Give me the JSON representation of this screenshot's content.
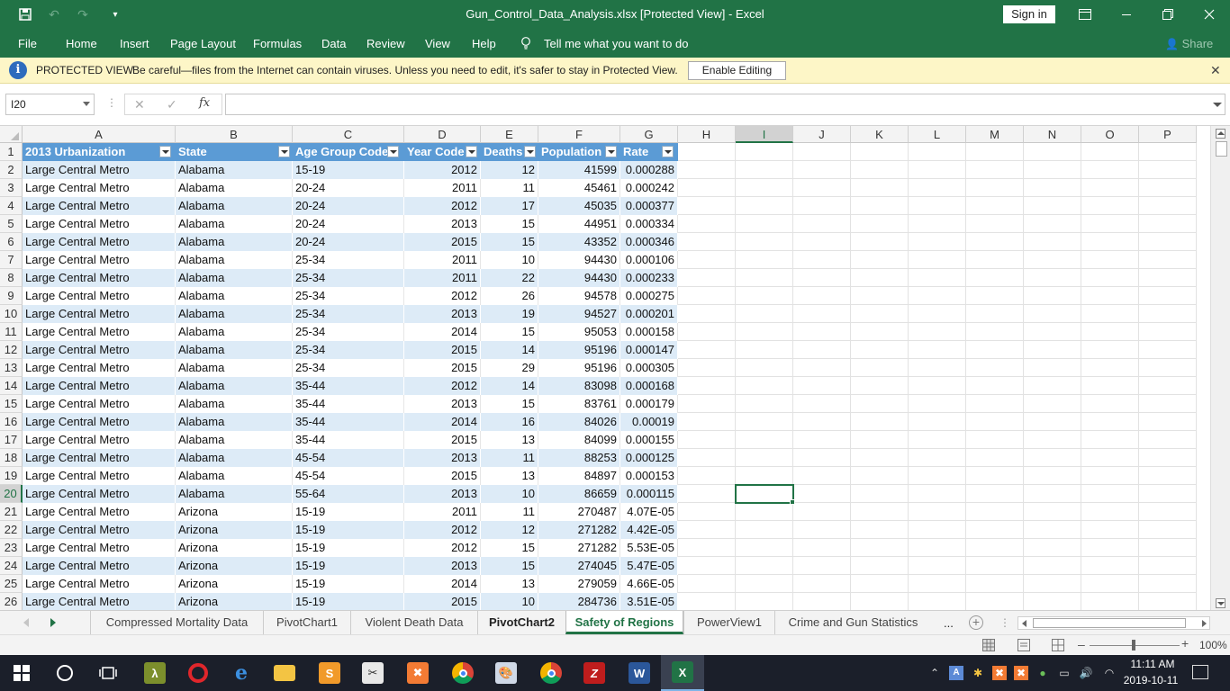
{
  "titlebar": {
    "title": "Gun_Control_Data_Analysis.xlsx  [Protected View]  -  Excel",
    "sign_in": "Sign in"
  },
  "ribbon": {
    "tabs": [
      "File",
      "Home",
      "Insert",
      "Page Layout",
      "Formulas",
      "Data",
      "Review",
      "View",
      "Help"
    ],
    "tell_me": "Tell me what you want to do",
    "share": "Share"
  },
  "protected_view": {
    "title": "PROTECTED VIEW",
    "message": "Be careful—files from the Internet can contain viruses. Unless you need to edit, it's safer to stay in Protected View.",
    "enable_button": "Enable Editing"
  },
  "formula_bar": {
    "name_box": "I20",
    "fx": "fx",
    "formula": ""
  },
  "sheet": {
    "column_letters": [
      "A",
      "B",
      "C",
      "D",
      "E",
      "F",
      "G",
      "H",
      "I",
      "J",
      "K",
      "L",
      "M",
      "N",
      "O",
      "P"
    ],
    "row_numbers": [
      "1",
      "2",
      "3",
      "4",
      "5",
      "6",
      "7",
      "8",
      "9",
      "10",
      "11",
      "12",
      "13",
      "14",
      "15",
      "16",
      "17",
      "18",
      "19",
      "20",
      "21",
      "22",
      "23",
      "24",
      "25",
      "26"
    ],
    "selected_column": "I",
    "selected_row": "20",
    "headers": [
      "2013 Urbanization",
      "State",
      "Age Group Code",
      "Year Code",
      "Deaths",
      "Population",
      "Rate"
    ],
    "rows": [
      [
        "Large Central Metro",
        "Alabama",
        "15-19",
        "2012",
        "12",
        "41599",
        "0.000288"
      ],
      [
        "Large Central Metro",
        "Alabama",
        "20-24",
        "2011",
        "11",
        "45461",
        "0.000242"
      ],
      [
        "Large Central Metro",
        "Alabama",
        "20-24",
        "2012",
        "17",
        "45035",
        "0.000377"
      ],
      [
        "Large Central Metro",
        "Alabama",
        "20-24",
        "2013",
        "15",
        "44951",
        "0.000334"
      ],
      [
        "Large Central Metro",
        "Alabama",
        "20-24",
        "2015",
        "15",
        "43352",
        "0.000346"
      ],
      [
        "Large Central Metro",
        "Alabama",
        "25-34",
        "2011",
        "10",
        "94430",
        "0.000106"
      ],
      [
        "Large Central Metro",
        "Alabama",
        "25-34",
        "2011",
        "22",
        "94430",
        "0.000233"
      ],
      [
        "Large Central Metro",
        "Alabama",
        "25-34",
        "2012",
        "26",
        "94578",
        "0.000275"
      ],
      [
        "Large Central Metro",
        "Alabama",
        "25-34",
        "2013",
        "19",
        "94527",
        "0.000201"
      ],
      [
        "Large Central Metro",
        "Alabama",
        "25-34",
        "2014",
        "15",
        "95053",
        "0.000158"
      ],
      [
        "Large Central Metro",
        "Alabama",
        "25-34",
        "2015",
        "14",
        "95196",
        "0.000147"
      ],
      [
        "Large Central Metro",
        "Alabama",
        "25-34",
        "2015",
        "29",
        "95196",
        "0.000305"
      ],
      [
        "Large Central Metro",
        "Alabama",
        "35-44",
        "2012",
        "14",
        "83098",
        "0.000168"
      ],
      [
        "Large Central Metro",
        "Alabama",
        "35-44",
        "2013",
        "15",
        "83761",
        "0.000179"
      ],
      [
        "Large Central Metro",
        "Alabama",
        "35-44",
        "2014",
        "16",
        "84026",
        "0.00019"
      ],
      [
        "Large Central Metro",
        "Alabama",
        "35-44",
        "2015",
        "13",
        "84099",
        "0.000155"
      ],
      [
        "Large Central Metro",
        "Alabama",
        "45-54",
        "2013",
        "11",
        "88253",
        "0.000125"
      ],
      [
        "Large Central Metro",
        "Alabama",
        "45-54",
        "2015",
        "13",
        "84897",
        "0.000153"
      ],
      [
        "Large Central Metro",
        "Alabama",
        "55-64",
        "2013",
        "10",
        "86659",
        "0.000115"
      ],
      [
        "Large Central Metro",
        "Arizona",
        "15-19",
        "2011",
        "11",
        "270487",
        "4.07E-05"
      ],
      [
        "Large Central Metro",
        "Arizona",
        "15-19",
        "2012",
        "12",
        "271282",
        "4.42E-05"
      ],
      [
        "Large Central Metro",
        "Arizona",
        "15-19",
        "2012",
        "15",
        "271282",
        "5.53E-05"
      ],
      [
        "Large Central Metro",
        "Arizona",
        "15-19",
        "2013",
        "15",
        "274045",
        "5.47E-05"
      ],
      [
        "Large Central Metro",
        "Arizona",
        "15-19",
        "2014",
        "13",
        "279059",
        "4.66E-05"
      ],
      [
        "Large Central Metro",
        "Arizona",
        "15-19",
        "2015",
        "10",
        "284736",
        "3.51E-05"
      ]
    ],
    "tabs": [
      {
        "label": "Compressed Mortality Data",
        "style": "normal"
      },
      {
        "label": "PivotChart1",
        "style": "normal"
      },
      {
        "label": "Violent Death Data",
        "style": "normal"
      },
      {
        "label": "PivotChart2",
        "style": "bold"
      },
      {
        "label": "Safety of Regions",
        "style": "active"
      },
      {
        "label": "PowerView1",
        "style": "normal"
      },
      {
        "label": "Crime and Gun Statistics",
        "style": "normal"
      }
    ],
    "more_tabs": "..."
  },
  "statusbar": {
    "zoom": "100%"
  },
  "taskbar": {
    "apps": [
      "start-icon",
      "cortana-icon",
      "task-view-icon",
      "app-icon",
      "opera-icon",
      "edge-icon",
      "file-explorer-icon",
      "sublime-text-icon",
      "snipping-tool-icon",
      "xampp-icon",
      "chrome-icon",
      "paint-icon",
      "chrome-icon",
      "filezilla-icon",
      "word-icon",
      "excel-icon"
    ],
    "time": "11:11 AM",
    "date": "2019-10-11"
  },
  "colors": {
    "excel_green": "#217346",
    "table_header_blue": "#5b9bd5",
    "table_band_blue": "#ddebf7",
    "protected_bar_yellow": "#fdf6c7"
  }
}
